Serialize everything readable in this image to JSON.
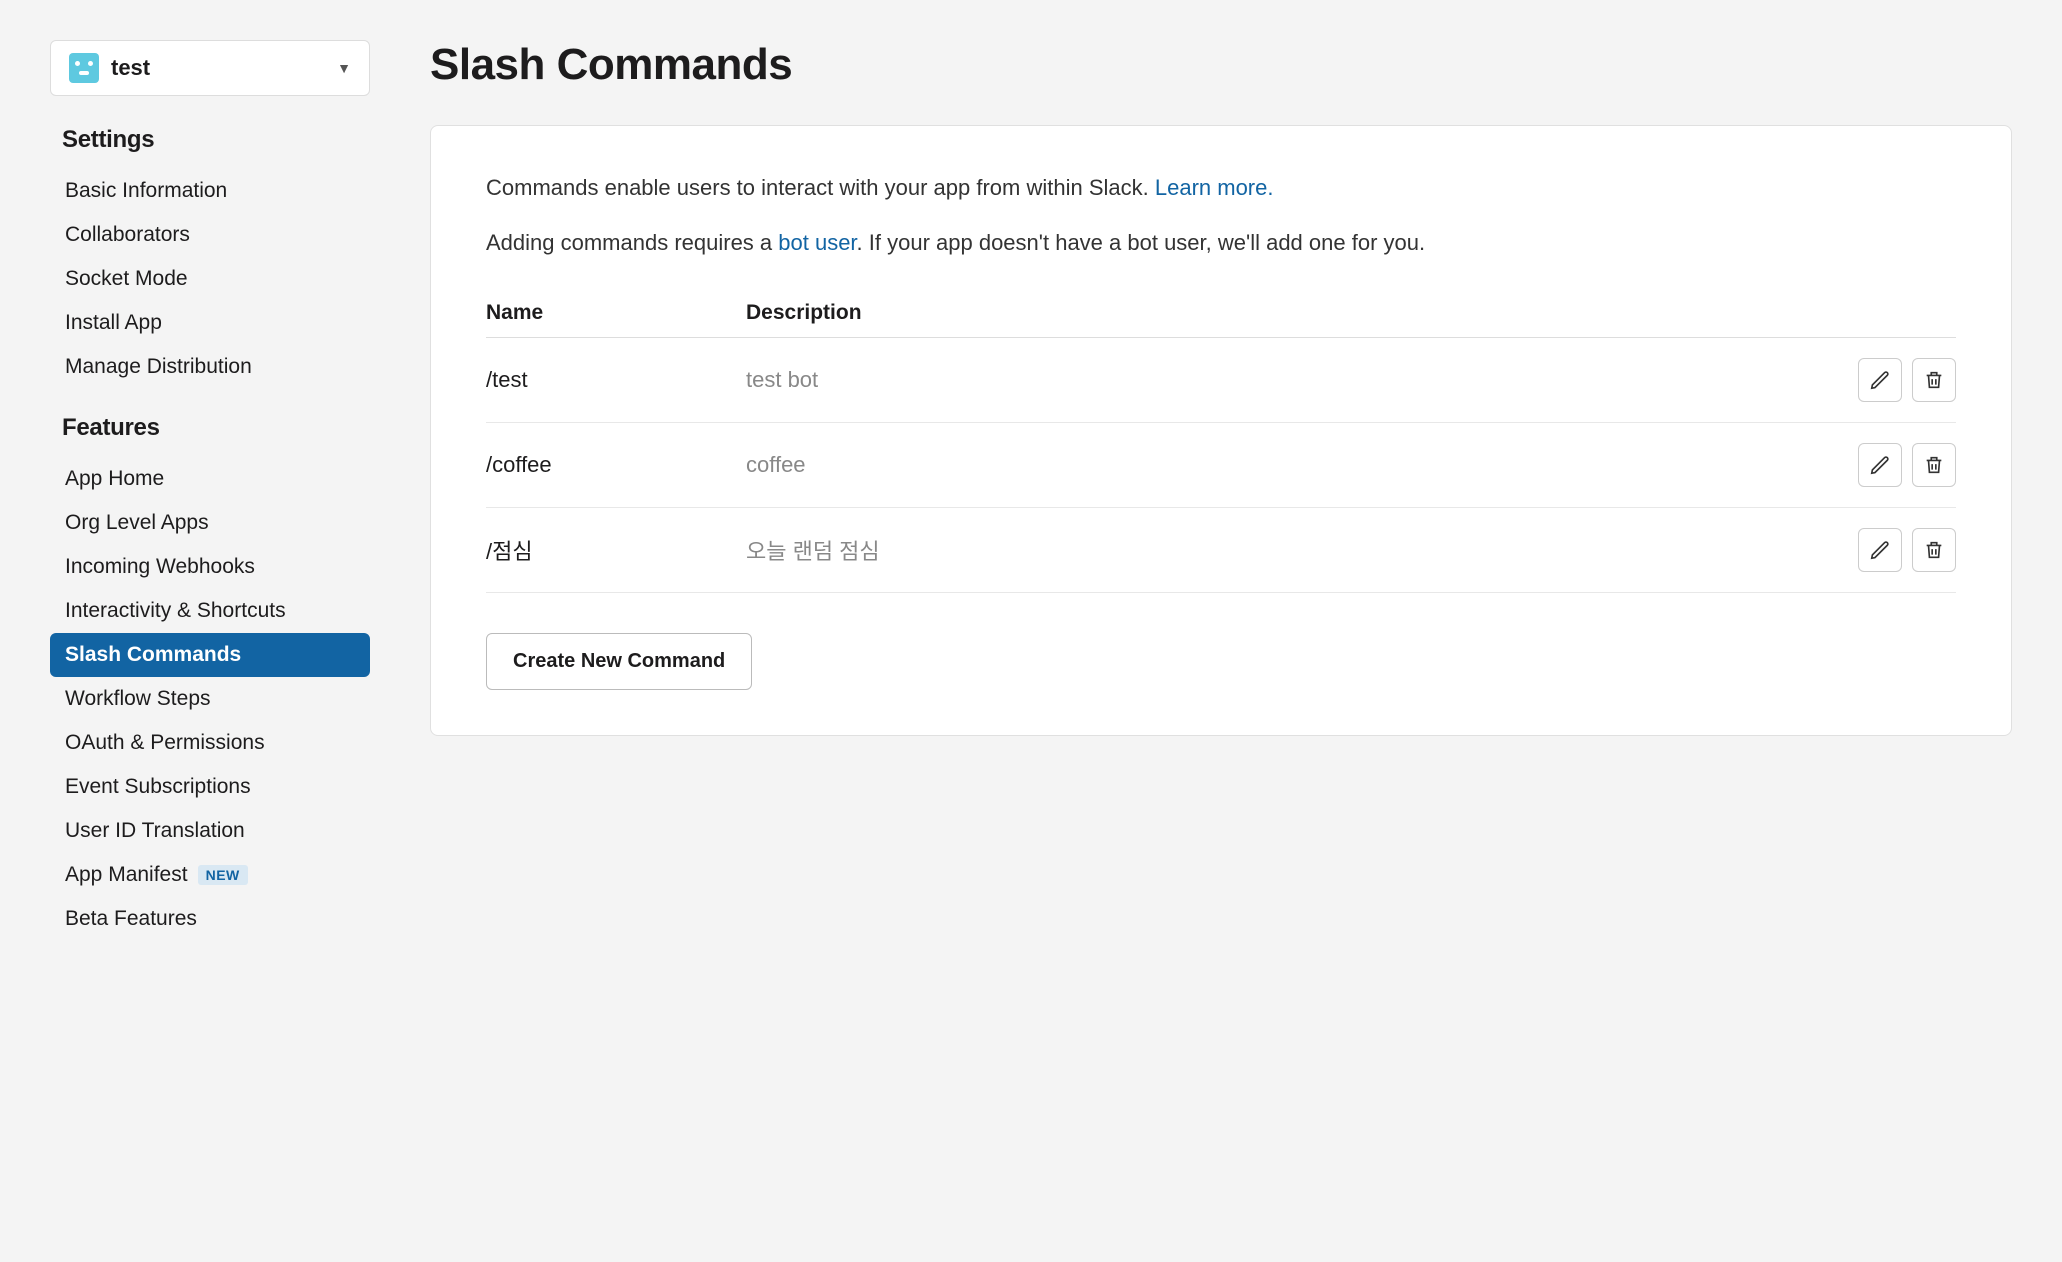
{
  "app_selector": {
    "name": "test"
  },
  "sidebar": {
    "settings_header": "Settings",
    "features_header": "Features",
    "settings_items": [
      {
        "label": "Basic Information",
        "active": false
      },
      {
        "label": "Collaborators",
        "active": false
      },
      {
        "label": "Socket Mode",
        "active": false
      },
      {
        "label": "Install App",
        "active": false
      },
      {
        "label": "Manage Distribution",
        "active": false
      }
    ],
    "features_items": [
      {
        "label": "App Home",
        "active": false
      },
      {
        "label": "Org Level Apps",
        "active": false
      },
      {
        "label": "Incoming Webhooks",
        "active": false
      },
      {
        "label": "Interactivity & Shortcuts",
        "active": false
      },
      {
        "label": "Slash Commands",
        "active": true
      },
      {
        "label": "Workflow Steps",
        "active": false
      },
      {
        "label": "OAuth & Permissions",
        "active": false
      },
      {
        "label": "Event Subscriptions",
        "active": false
      },
      {
        "label": "User ID Translation",
        "active": false
      },
      {
        "label": "App Manifest",
        "active": false,
        "badge": "NEW"
      },
      {
        "label": "Beta Features",
        "active": false
      }
    ]
  },
  "main": {
    "title": "Slash Commands",
    "intro1_pre": "Commands enable users to interact with your app from within Slack. ",
    "intro1_link": "Learn more.",
    "intro2_pre": "Adding commands requires a ",
    "intro2_link": "bot user",
    "intro2_post": ". If your app doesn't have a bot user, we'll add one for you.",
    "table": {
      "col_name": "Name",
      "col_desc": "Description",
      "rows": [
        {
          "name": "/test",
          "desc": "test bot"
        },
        {
          "name": "/coffee",
          "desc": "coffee"
        },
        {
          "name": "/점심",
          "desc": "오늘 랜덤 점심"
        }
      ]
    },
    "create_btn": "Create New Command"
  }
}
